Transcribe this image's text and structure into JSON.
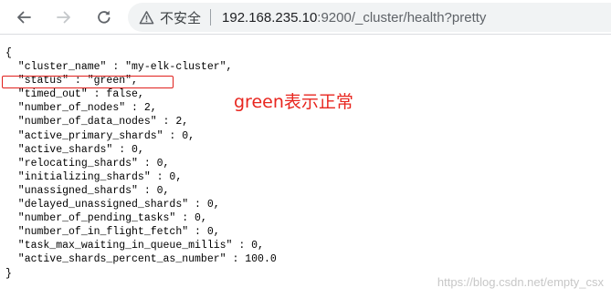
{
  "toolbar": {
    "security_label": "不安全",
    "url_host": "192.168.235.10",
    "url_rest": ":9200/_cluster/health?pretty"
  },
  "json_lines": [
    "{",
    "  \"cluster_name\" : \"my-elk-cluster\",",
    "  \"status\" : \"green\",",
    "  \"timed_out\" : false,",
    "  \"number_of_nodes\" : 2,",
    "  \"number_of_data_nodes\" : 2,",
    "  \"active_primary_shards\" : 0,",
    "  \"active_shards\" : 0,",
    "  \"relocating_shards\" : 0,",
    "  \"initializing_shards\" : 0,",
    "  \"unassigned_shards\" : 0,",
    "  \"delayed_unassigned_shards\" : 0,",
    "  \"number_of_pending_tasks\" : 0,",
    "  \"number_of_in_flight_fetch\" : 0,",
    "  \"task_max_waiting_in_queue_millis\" : 0,",
    "  \"active_shards_percent_as_number\" : 100.0",
    "}"
  ],
  "annotation": {
    "text": "green表示正常",
    "color": "#e8261f"
  },
  "watermark": "https://blog.csdn.net/empty_csx",
  "icons": {
    "back": "back-arrow-icon",
    "forward": "forward-arrow-icon",
    "reload": "reload-icon",
    "security": "warning-triangle-icon"
  }
}
